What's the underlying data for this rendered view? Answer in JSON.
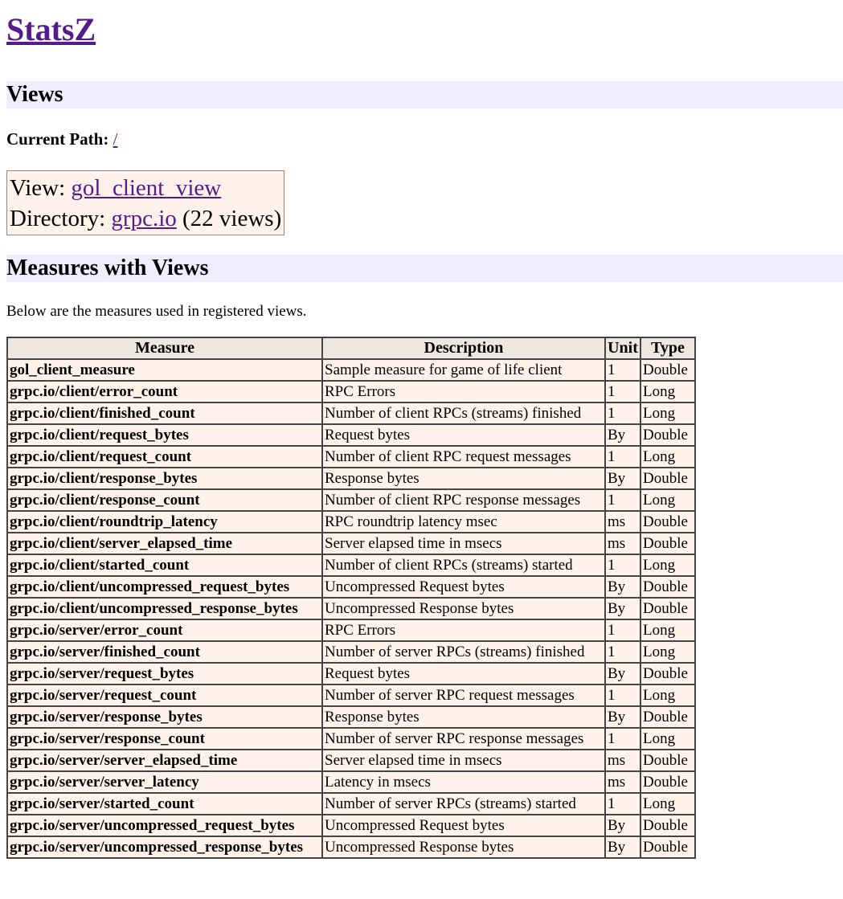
{
  "page": {
    "title": "StatsZ"
  },
  "views_section": {
    "heading": "Views",
    "current_path_label": "Current Path:",
    "current_path_link": "/",
    "view_label": "View:",
    "view_link": "gol_client_view",
    "directory_label": "Directory:",
    "directory_link": "grpc.io",
    "directory_count": "(22 views)"
  },
  "measures_section": {
    "heading": "Measures with Views",
    "description": "Below are the measures used in registered views.",
    "columns": [
      "Measure",
      "Description",
      "Unit",
      "Type"
    ],
    "rows": [
      {
        "measure": "gol_client_measure",
        "description": "Sample measure for game of life client",
        "unit": "1",
        "type": "Double"
      },
      {
        "measure": "grpc.io/client/error_count",
        "description": "RPC Errors",
        "unit": "1",
        "type": "Long"
      },
      {
        "measure": "grpc.io/client/finished_count",
        "description": "Number of client RPCs (streams) finished",
        "unit": "1",
        "type": "Long"
      },
      {
        "measure": "grpc.io/client/request_bytes",
        "description": "Request bytes",
        "unit": "By",
        "type": "Double"
      },
      {
        "measure": "grpc.io/client/request_count",
        "description": "Number of client RPC request messages",
        "unit": "1",
        "type": "Long"
      },
      {
        "measure": "grpc.io/client/response_bytes",
        "description": "Response bytes",
        "unit": "By",
        "type": "Double"
      },
      {
        "measure": "grpc.io/client/response_count",
        "description": "Number of client RPC response messages",
        "unit": "1",
        "type": "Long"
      },
      {
        "measure": "grpc.io/client/roundtrip_latency",
        "description": "RPC roundtrip latency msec",
        "unit": "ms",
        "type": "Double"
      },
      {
        "measure": "grpc.io/client/server_elapsed_time",
        "description": "Server elapsed time in msecs",
        "unit": "ms",
        "type": "Double"
      },
      {
        "measure": "grpc.io/client/started_count",
        "description": "Number of client RPCs (streams) started",
        "unit": "1",
        "type": "Long"
      },
      {
        "measure": "grpc.io/client/uncompressed_request_bytes",
        "description": "Uncompressed Request bytes",
        "unit": "By",
        "type": "Double"
      },
      {
        "measure": "grpc.io/client/uncompressed_response_bytes",
        "description": "Uncompressed Response bytes",
        "unit": "By",
        "type": "Double"
      },
      {
        "measure": "grpc.io/server/error_count",
        "description": "RPC Errors",
        "unit": "1",
        "type": "Long"
      },
      {
        "measure": "grpc.io/server/finished_count",
        "description": "Number of server RPCs (streams) finished",
        "unit": "1",
        "type": "Long"
      },
      {
        "measure": "grpc.io/server/request_bytes",
        "description": "Request bytes",
        "unit": "By",
        "type": "Double"
      },
      {
        "measure": "grpc.io/server/request_count",
        "description": "Number of server RPC request messages",
        "unit": "1",
        "type": "Long"
      },
      {
        "measure": "grpc.io/server/response_bytes",
        "description": "Response bytes",
        "unit": "By",
        "type": "Double"
      },
      {
        "measure": "grpc.io/server/response_count",
        "description": "Number of server RPC response messages",
        "unit": "1",
        "type": "Long"
      },
      {
        "measure": "grpc.io/server/server_elapsed_time",
        "description": "Server elapsed time in msecs",
        "unit": "ms",
        "type": "Double"
      },
      {
        "measure": "grpc.io/server/server_latency",
        "description": "Latency in msecs",
        "unit": "ms",
        "type": "Double"
      },
      {
        "measure": "grpc.io/server/started_count",
        "description": "Number of server RPCs (streams) started",
        "unit": "1",
        "type": "Long"
      },
      {
        "measure": "grpc.io/server/uncompressed_request_bytes",
        "description": "Uncompressed Request bytes",
        "unit": "By",
        "type": "Double"
      },
      {
        "measure": "grpc.io/server/uncompressed_response_bytes",
        "description": "Uncompressed Response bytes",
        "unit": "By",
        "type": "Double"
      }
    ]
  },
  "colors": {
    "link": "#551a8b",
    "section_heading_bg": "#eeeeff",
    "cell_bg": "#fff2ea",
    "header_bg": "#eee7e0"
  }
}
